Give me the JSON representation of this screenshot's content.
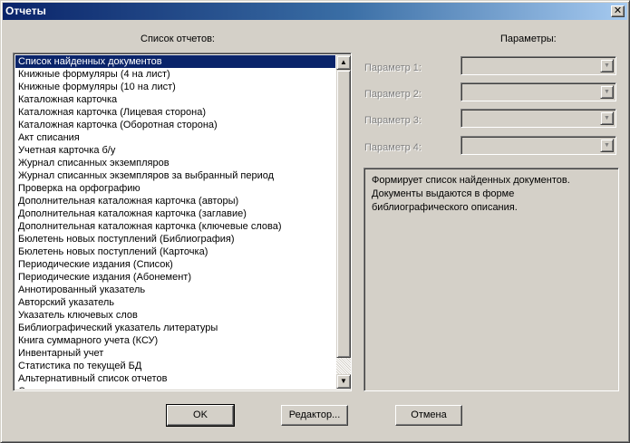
{
  "window": {
    "title": "Отчеты",
    "close_glyph": "✕"
  },
  "reports": {
    "header": "Список отчетов:",
    "items": [
      "Список найденных документов",
      "Книжные формуляры (4 на лист)",
      "Книжные формуляры (10 на лист)",
      "Каталожная карточка",
      "Каталожная карточка (Лицевая сторона)",
      "Каталожная карточка (Оборотная сторона)",
      "Акт списания",
      "Учетная карточка б/у",
      "Журнал списанных экземпляров",
      "Журнал списанных экземпляров за выбранный период",
      "Проверка на орфографию",
      "Дополнительная каталожная карточка (авторы)",
      "Дополнительная каталожная карточка (заглавие)",
      "Дополнительная каталожная карточка (ключевые слова)",
      "Бюлетень новых поступлений (Библиография)",
      "Бюлетень новых поступлений (Карточка)",
      "Периодические издания (Список)",
      "Периодические издания (Абонемент)",
      "Аннотированный указатель",
      "Авторский указатель",
      "Указатель ключевых слов",
      "Библиографический указатель литературы",
      "Книга суммарного учета (КСУ)",
      "Инвентарный учет",
      "Статистика по текущей БД",
      "Альтернативный список отчетов",
      "Системные операции"
    ],
    "selected_index": 0
  },
  "params": {
    "header": "Параметры:",
    "labels": [
      "Параметр 1:",
      "Параметр 2:",
      "Параметр 3:",
      "Параметр 4:"
    ]
  },
  "description": "Формирует список найденных документов. Документы выдаются в форме библиографического описания.",
  "buttons": {
    "ok": "OK",
    "editor": "Редактор...",
    "cancel": "Отмена"
  },
  "icons": {
    "scroll_up": "▲",
    "scroll_down": "▼",
    "combo_arrow": "▼"
  },
  "colors": {
    "selection": "#0a246a",
    "face": "#d4d0c8",
    "disabled_text": "#808080"
  }
}
